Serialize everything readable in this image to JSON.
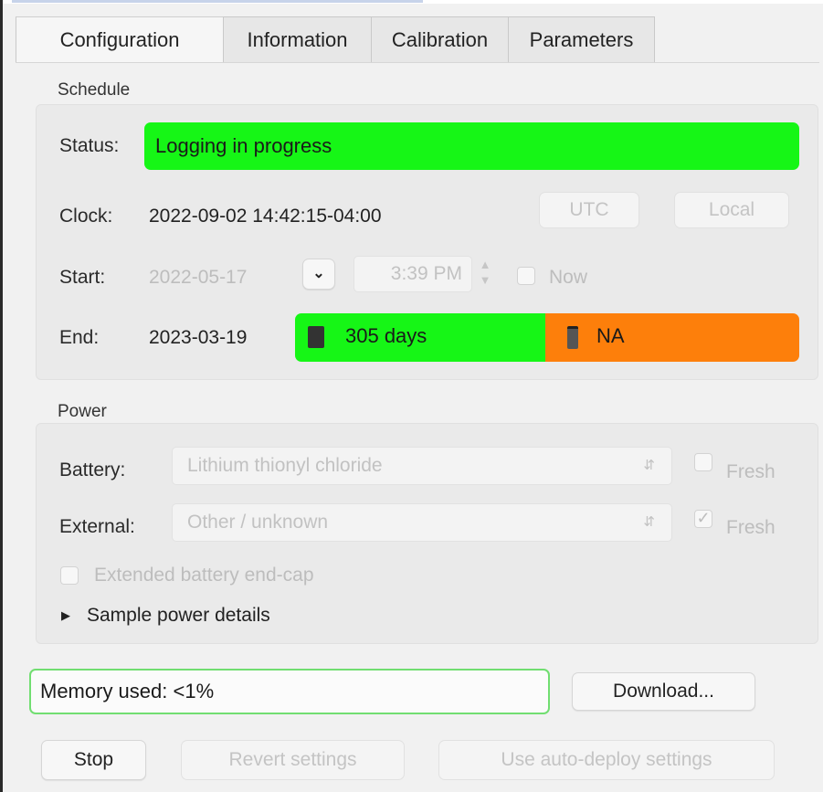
{
  "tabs": [
    {
      "label": "Configuration",
      "active": true
    },
    {
      "label": "Information",
      "active": false
    },
    {
      "label": "Calibration",
      "active": false
    },
    {
      "label": "Parameters",
      "active": false
    }
  ],
  "schedule": {
    "section_label": "Schedule",
    "status_label": "Status:",
    "status_value": "Logging in progress",
    "status_color": "#16f616",
    "clock_label": "Clock:",
    "clock_value": "2022-09-02 14:42:15-04:00",
    "utc_button": "UTC",
    "local_button": "Local",
    "start_label": "Start:",
    "start_date": "2022-05-17",
    "start_time": "3:39 PM",
    "now_label": "Now",
    "now_checked": false,
    "end_label": "End:",
    "end_date": "2023-03-19",
    "memory_life": "305 days",
    "battery_life": "NA",
    "memory_life_color": "#16f616",
    "battery_life_color": "#fd7f0b"
  },
  "power": {
    "section_label": "Power",
    "battery_label": "Battery:",
    "battery_value": "Lithium thionyl chloride",
    "battery_fresh_label": "Fresh",
    "battery_fresh_checked": false,
    "external_label": "External:",
    "external_value": "Other / unknown",
    "external_fresh_label": "Fresh",
    "external_fresh_checked": true,
    "endcap_label": "Extended battery end-cap",
    "endcap_checked": false,
    "details_label": "Sample power details"
  },
  "memory": {
    "label": "Memory used: <1%"
  },
  "buttons": {
    "download": "Download...",
    "stop": "Stop",
    "revert": "Revert settings",
    "auto_deploy": "Use auto-deploy settings"
  }
}
